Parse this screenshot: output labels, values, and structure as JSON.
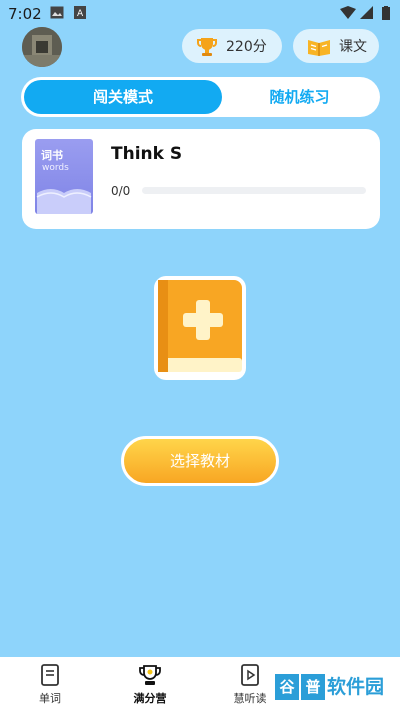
{
  "status_bar": {
    "time": "7:02",
    "icons": [
      "image-icon",
      "notification-a-icon",
      "wifi-icon",
      "signal-icon",
      "battery-icon"
    ]
  },
  "header": {
    "score_label": "220分",
    "text_label": "课文",
    "icons": [
      "trophy-icon",
      "book-open-icon"
    ]
  },
  "tabs": [
    {
      "label": "闯关模式",
      "active": true
    },
    {
      "label": "随机练习",
      "active": false
    }
  ],
  "book": {
    "cover_title": "词书",
    "cover_subtitle": "words",
    "title": "Think S",
    "progress_text": "0/0",
    "progress": 0
  },
  "add_book": {
    "icon": "add-book-icon"
  },
  "select_button": {
    "label": "选择教材"
  },
  "bottom_nav": {
    "items": [
      {
        "label": "单词",
        "icon": "book-icon",
        "active": false
      },
      {
        "label": "满分营",
        "icon": "trophy-outline-icon",
        "active": true
      },
      {
        "label": "慧听读",
        "icon": "play-icon",
        "active": false
      }
    ]
  },
  "watermark": {
    "text": "谷普软件园"
  },
  "colors": {
    "background": "#8ed4fb",
    "accent": "#12aaf2",
    "button_orange": "#f8a623"
  }
}
